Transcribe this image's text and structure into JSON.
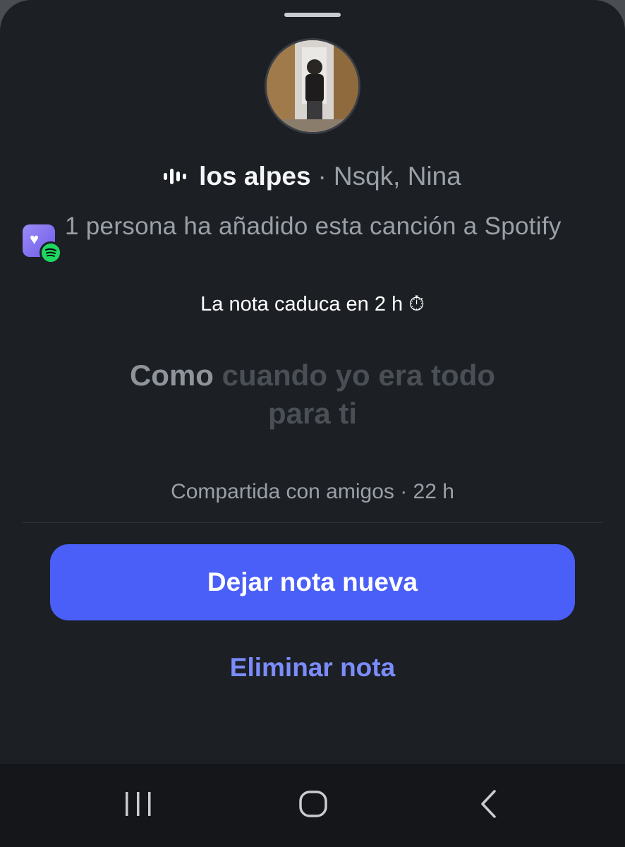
{
  "song": {
    "title": "los alpes",
    "separator": "·",
    "artists": "Nsqk, Nina"
  },
  "spotify_added": {
    "text": "1 persona ha añadido esta canción a Spotify"
  },
  "note": {
    "expires_label": "La nota caduca en 2 h ⏱",
    "lyric_first_word": "Como",
    "lyric_rest": "cuando yo era todo para ti",
    "shared_label": "Compartida con amigos · 22 h"
  },
  "actions": {
    "primary_label": "Dejar nota nueva",
    "secondary_label": "Eliminar nota"
  },
  "navbar": {
    "recents_icon": "recents-icon",
    "home_icon": "home-icon",
    "back_icon": "back-icon"
  },
  "colors": {
    "background": "#1c1f24",
    "primary_button": "#4a5ff7",
    "link": "#7b8cfb",
    "spotify_green": "#1ed760"
  }
}
